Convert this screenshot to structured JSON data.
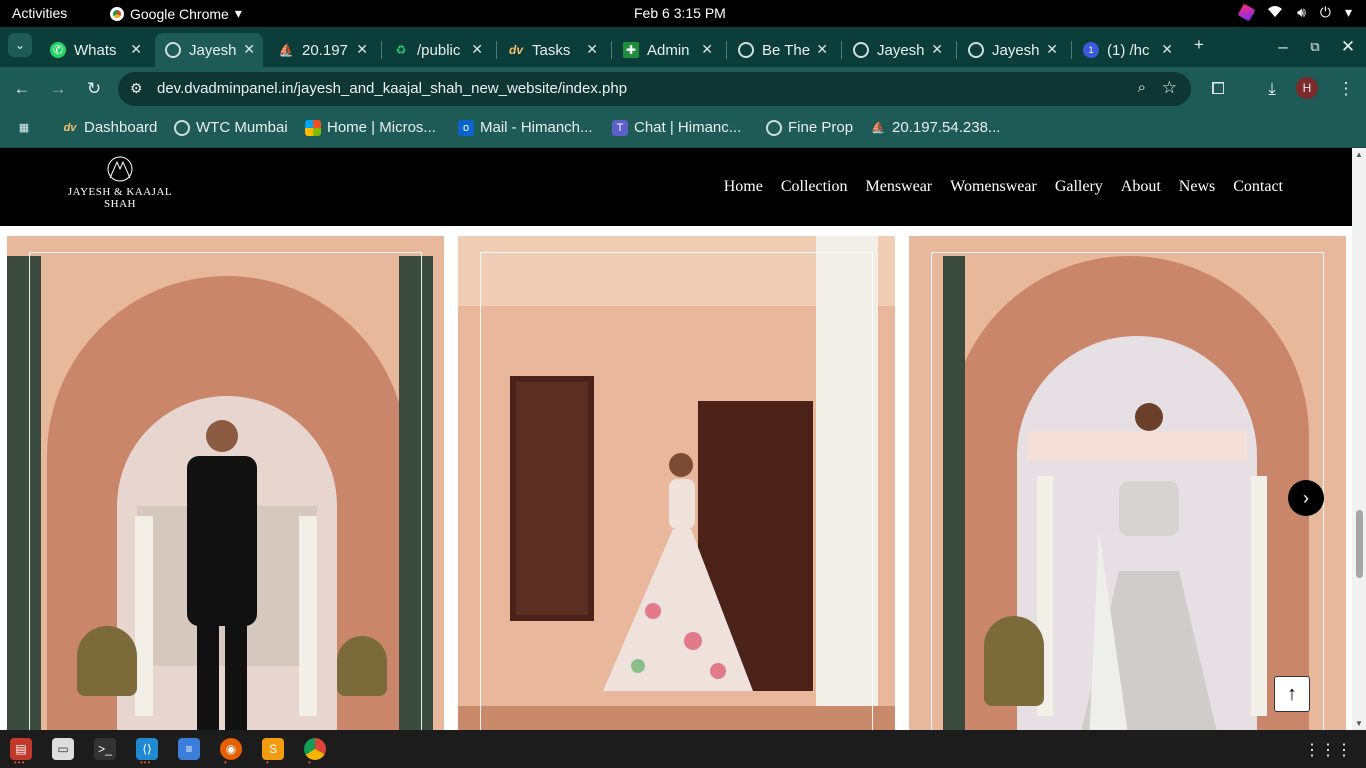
{
  "topbar": {
    "activities": "Activities",
    "app_name": "Google Chrome",
    "clock": "Feb 6  3:15 PM"
  },
  "tabs": [
    {
      "label": "Whats",
      "icon": "whatsapp-icon"
    },
    {
      "label": "Jayesh",
      "icon": "globe-icon",
      "active": true
    },
    {
      "label": "20.197",
      "icon": "ship-icon"
    },
    {
      "label": "/public",
      "icon": "recycle-icon"
    },
    {
      "label": "Tasks",
      "icon": "dv-icon"
    },
    {
      "label": "Admin",
      "icon": "sheet-icon"
    },
    {
      "label": "Be The",
      "icon": "globe-icon"
    },
    {
      "label": "Jayesh",
      "icon": "globe-icon"
    },
    {
      "label": "Jayesh",
      "icon": "globe-icon"
    },
    {
      "label": "(1) /hc",
      "icon": "notif-icon"
    }
  ],
  "address": {
    "url": "dev.dvadminpanel.in/jayesh_and_kaajal_shah_new_website/index.php"
  },
  "profile_initial": "H",
  "bookmarks": [
    {
      "label": "Dashboard",
      "icon": "dv-icon"
    },
    {
      "label": "WTC Mumbai",
      "icon": "globe-icon"
    },
    {
      "label": "Home | Micros...",
      "icon": "microsoft-icon"
    },
    {
      "label": "Mail - Himanch...",
      "icon": "outlook-icon"
    },
    {
      "label": "Chat | Himanc...",
      "icon": "teams-icon"
    },
    {
      "label": "Fine Prop",
      "icon": "globe-icon"
    },
    {
      "label": "20.197.54.238...",
      "icon": "ship-icon"
    }
  ],
  "site": {
    "logo_line1": "JAYESH & KAAJAL",
    "logo_line2": "SHAH",
    "nav": [
      "Home",
      "Collection",
      "Menswear",
      "Womenswear",
      "Gallery",
      "About",
      "News",
      "Contact"
    ]
  },
  "colors": {
    "chrome_dark": "#0b3d3a",
    "chrome_toolbar": "#1f5b56",
    "site_header": "#000000",
    "wall_peach": "#e9b79c",
    "pillar_white": "#f2efe8"
  }
}
